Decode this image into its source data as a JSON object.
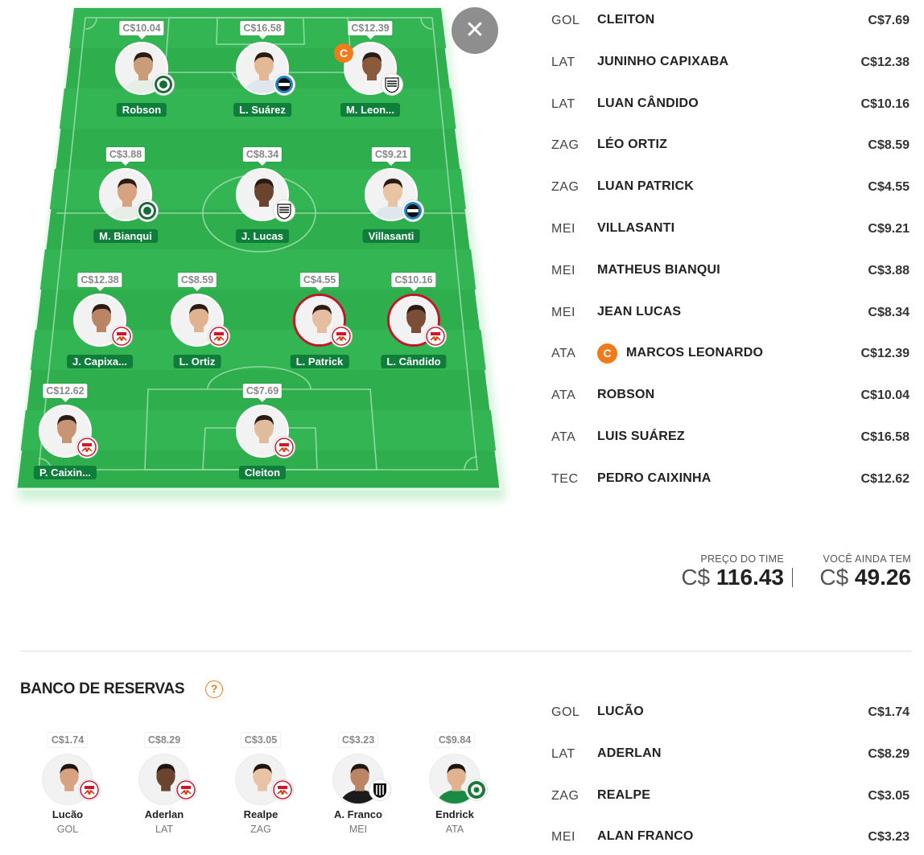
{
  "close_icon": "close-icon",
  "field_players": [
    {
      "name": "Robson",
      "price": "C$10.04",
      "club": "coritiba",
      "captain": false,
      "ring": "white"
    },
    {
      "name": "L. Suárez",
      "price": "C$16.58",
      "club": "gremio",
      "captain": false,
      "ring": "white"
    },
    {
      "name": "M. Leon...",
      "price": "C$12.39",
      "club": "santos",
      "captain": true,
      "captain_label": "C",
      "ring": "white"
    },
    {
      "name": "M. Bianqui",
      "price": "C$3.88",
      "club": "coritiba",
      "captain": false,
      "ring": "white"
    },
    {
      "name": "J. Lucas",
      "price": "C$8.34",
      "club": "santos",
      "captain": false,
      "ring": "white"
    },
    {
      "name": "Villasanti",
      "price": "C$9.21",
      "club": "gremio",
      "captain": false,
      "ring": "white"
    },
    {
      "name": "J. Capixa...",
      "price": "C$12.38",
      "club": "bragantino",
      "captain": false,
      "ring": "white"
    },
    {
      "name": "L. Ortiz",
      "price": "C$8.59",
      "club": "bragantino",
      "captain": false,
      "ring": "white"
    },
    {
      "name": "L. Patrick",
      "price": "C$4.55",
      "club": "bragantino",
      "captain": false,
      "ring": "red"
    },
    {
      "name": "L. Cândido",
      "price": "C$10.16",
      "club": "bragantino",
      "captain": false,
      "ring": "red"
    },
    {
      "name": "P. Caixin...",
      "price": "C$12.62",
      "club": "bragantino",
      "captain": false,
      "ring": "white"
    },
    {
      "name": "Cleiton",
      "price": "C$7.69",
      "club": "bragantino",
      "captain": false,
      "ring": "white"
    }
  ],
  "squad_list": [
    {
      "pos": "GOL",
      "name": "CLEITON",
      "price": "C$7.69",
      "captain": false
    },
    {
      "pos": "LAT",
      "name": "JUNINHO CAPIXABA",
      "price": "C$12.38",
      "captain": false
    },
    {
      "pos": "LAT",
      "name": "LUAN CÂNDIDO",
      "price": "C$10.16",
      "captain": false
    },
    {
      "pos": "ZAG",
      "name": "LÉO ORTIZ",
      "price": "C$8.59",
      "captain": false
    },
    {
      "pos": "ZAG",
      "name": "LUAN PATRICK",
      "price": "C$4.55",
      "captain": false
    },
    {
      "pos": "MEI",
      "name": "VILLASANTI",
      "price": "C$9.21",
      "captain": false
    },
    {
      "pos": "MEI",
      "name": "MATHEUS BIANQUI",
      "price": "C$3.88",
      "captain": false
    },
    {
      "pos": "MEI",
      "name": "JEAN LUCAS",
      "price": "C$8.34",
      "captain": false
    },
    {
      "pos": "ATA",
      "name": "MARCOS LEONARDO",
      "price": "C$12.39",
      "captain": true,
      "captain_label": "C"
    },
    {
      "pos": "ATA",
      "name": "ROBSON",
      "price": "C$10.04",
      "captain": false
    },
    {
      "pos": "ATA",
      "name": "LUIS SUÁREZ",
      "price": "C$16.58",
      "captain": false
    },
    {
      "pos": "TEC",
      "name": "PEDRO CAIXINHA",
      "price": "C$12.62",
      "captain": false
    }
  ],
  "totals": {
    "team_price_label": "PREÇO DO TIME",
    "team_price_currency": "C$",
    "team_price_value": "116.43",
    "remaining_label": "VOCÊ AINDA TEM",
    "remaining_currency": "C$",
    "remaining_value": "49.26"
  },
  "bench": {
    "title": "BANCO DE RESERVAS",
    "help_label": "?",
    "players": [
      {
        "name": "Lucão",
        "pos": "GOL",
        "price": "C$1.74",
        "club": "bragantino"
      },
      {
        "name": "Aderlan",
        "pos": "LAT",
        "price": "C$8.29",
        "club": "bragantino"
      },
      {
        "name": "Realpe",
        "pos": "ZAG",
        "price": "C$3.05",
        "club": "bragantino"
      },
      {
        "name": "A. Franco",
        "pos": "MEI",
        "price": "C$3.23",
        "club": "atletico-mg"
      },
      {
        "name": "Endrick",
        "pos": "ATA",
        "price": "C$9.84",
        "club": "palmeiras"
      }
    ],
    "list": [
      {
        "pos": "GOL",
        "name": "LUCÃO",
        "price": "C$1.74"
      },
      {
        "pos": "LAT",
        "name": "ADERLAN",
        "price": "C$8.29"
      },
      {
        "pos": "ZAG",
        "name": "REALPE",
        "price": "C$3.05"
      },
      {
        "pos": "MEI",
        "name": "ALAN FRANCO",
        "price": "C$3.23"
      }
    ]
  },
  "colors": {
    "field_green": "#2fae4e",
    "field_green_dark": "#28a247",
    "name_tag": "#0f7e3b",
    "captain_orange": "#f07b1a",
    "highlight_red": "#c0182a"
  }
}
